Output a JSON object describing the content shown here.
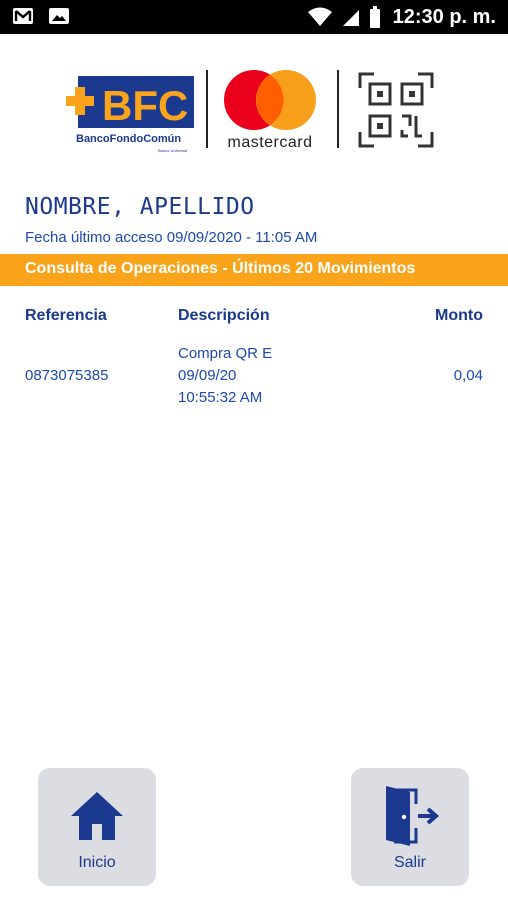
{
  "status_bar": {
    "time": "12:30 p. m.",
    "left_icons": [
      "gmail-icon",
      "image-icon"
    ],
    "right_icons": [
      "wifi-icon",
      "signal-icon",
      "battery-icon"
    ]
  },
  "logos": {
    "bank_logo_text": "BFC",
    "bank_logo_subtext": "BancoFondoComún",
    "bank_logo_tagline": "Banco Universal",
    "card_brand": "mastercard",
    "qr_icon": "qr-code-icon"
  },
  "user": {
    "name": "NOMBRE, APELLIDO",
    "last_access": "Fecha último acceso 09/09/2020 - 11:05 AM"
  },
  "section": {
    "title": "Consulta de Operaciones - Últimos 20 Movimientos"
  },
  "table": {
    "headers": {
      "reference": "Referencia",
      "description": "Descripción",
      "amount": "Monto"
    },
    "rows": [
      {
        "reference": "0873075385",
        "description": "Compra QR E\n09/09/20\n10:55:32 AM",
        "amount": "0,04"
      }
    ]
  },
  "nav": {
    "home_label": "Inicio",
    "exit_label": "Salir",
    "home_icon": "home-icon",
    "exit_icon": "exit-door-icon"
  },
  "colors": {
    "primary_blue": "#1b3a8f",
    "accent_orange": "#f9a41a",
    "mc_red": "#eb001b",
    "mc_yellow": "#f79e1b",
    "button_gray": "#dcdde2"
  }
}
